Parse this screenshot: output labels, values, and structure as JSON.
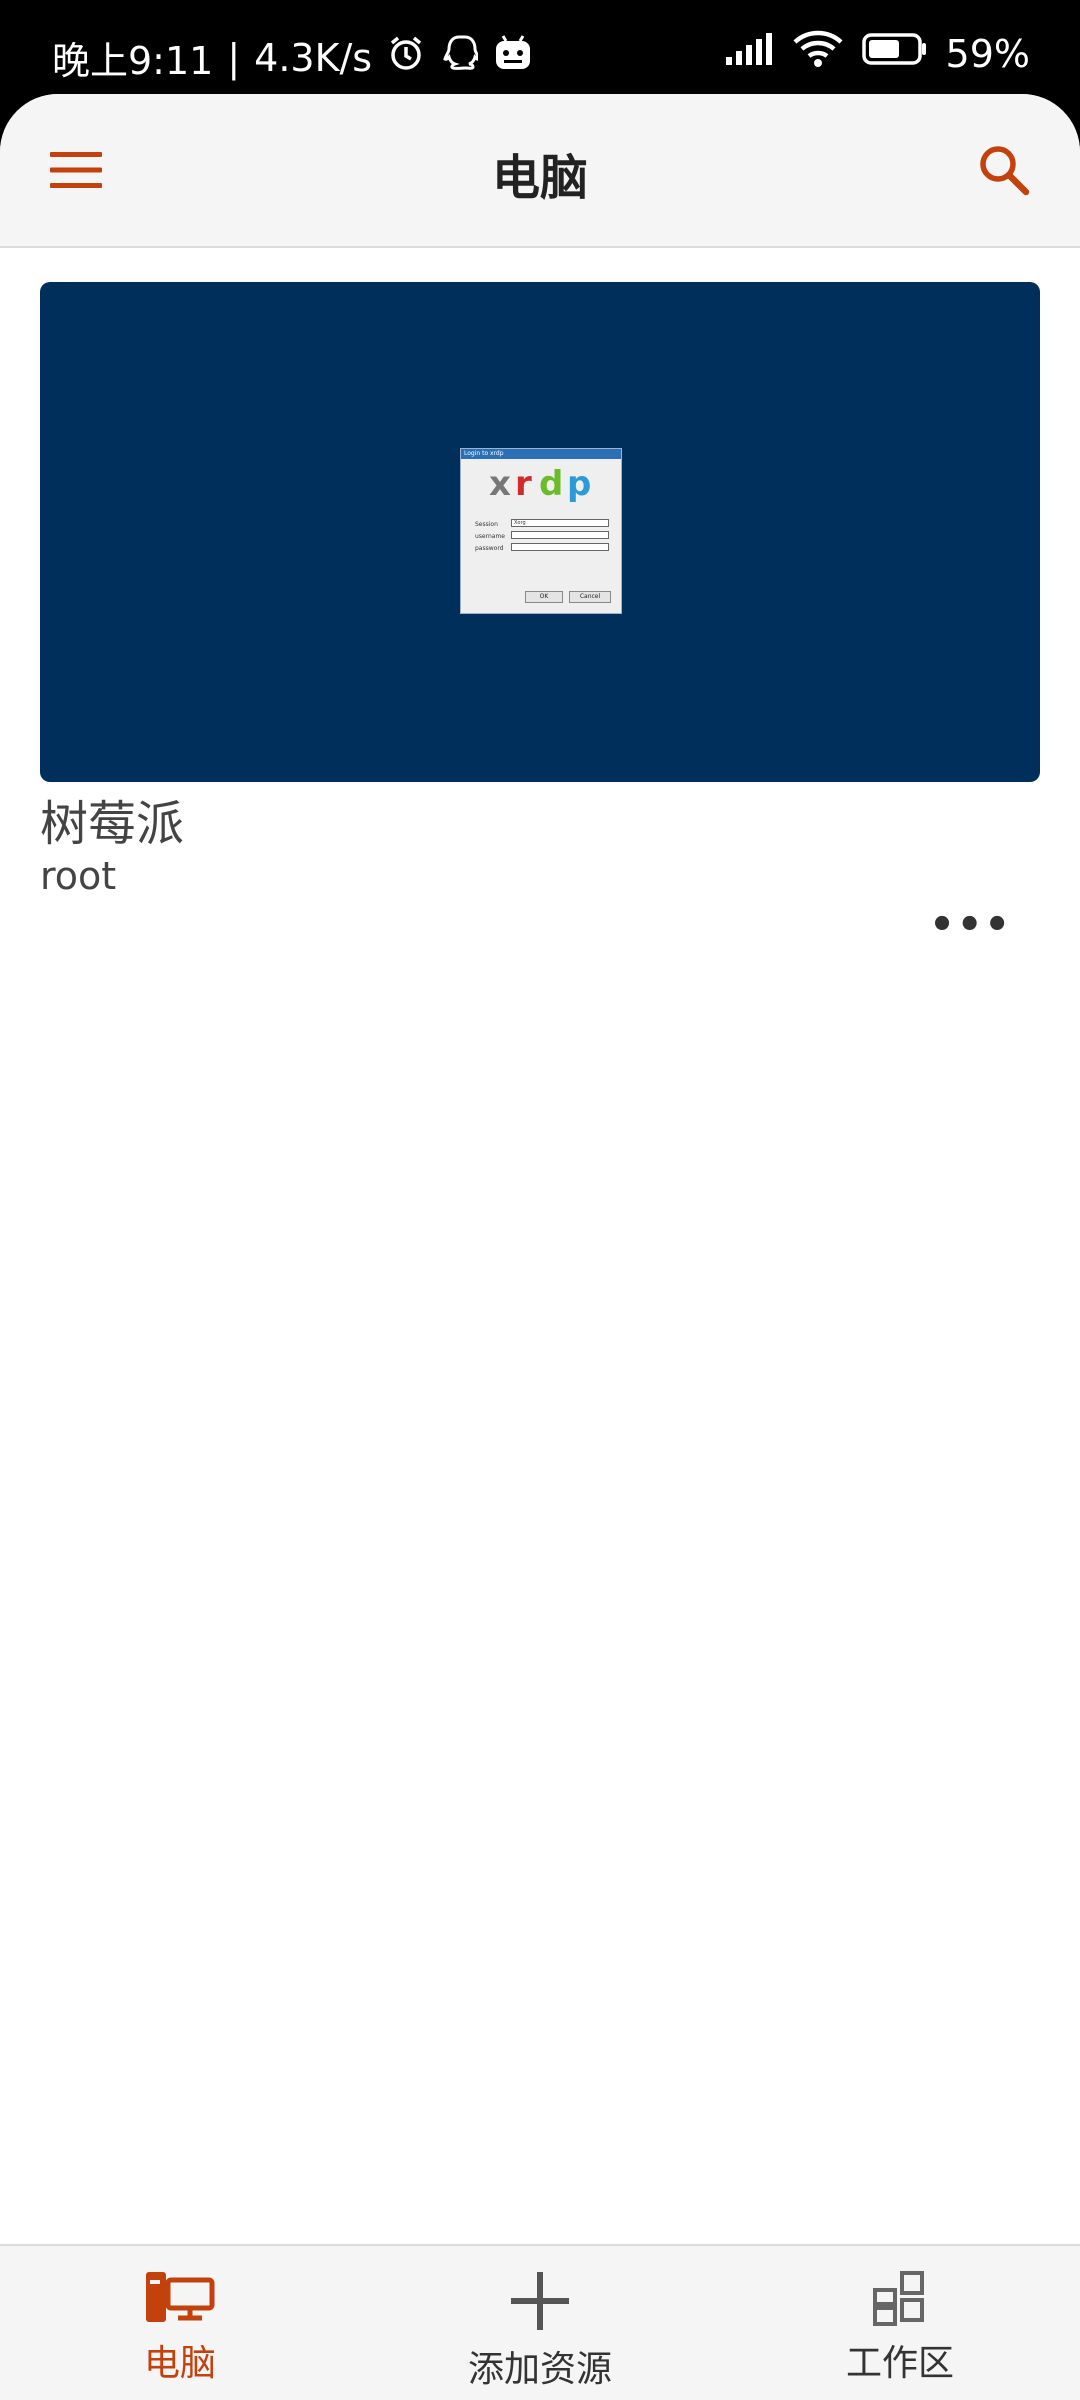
{
  "status_bar": {
    "time": "晚上9:11",
    "network_speed": "4.3K/s",
    "battery": "59%"
  },
  "header": {
    "title": "电脑"
  },
  "computer_card": {
    "name": "树莓派",
    "user": "root",
    "more": "•••",
    "preview": {
      "dialog_title": "Login to xrdp",
      "logo_x": "x",
      "logo_r": "r",
      "logo_d": "d",
      "logo_p": "p",
      "session_label": "Session",
      "session_value": "Xorg",
      "username_label": "username",
      "password_label": "password",
      "ok_label": "OK",
      "cancel_label": "Cancel"
    }
  },
  "bottom_nav": {
    "items": [
      {
        "label": "电脑",
        "icon": "computer-icon",
        "active": true
      },
      {
        "label": "添加资源",
        "icon": "plus-icon",
        "active": false
      },
      {
        "label": "工作区",
        "icon": "grid-icon",
        "active": false
      }
    ]
  },
  "colors": {
    "accent": "#c2410c",
    "thumbnail_bg": "#002f5b"
  }
}
